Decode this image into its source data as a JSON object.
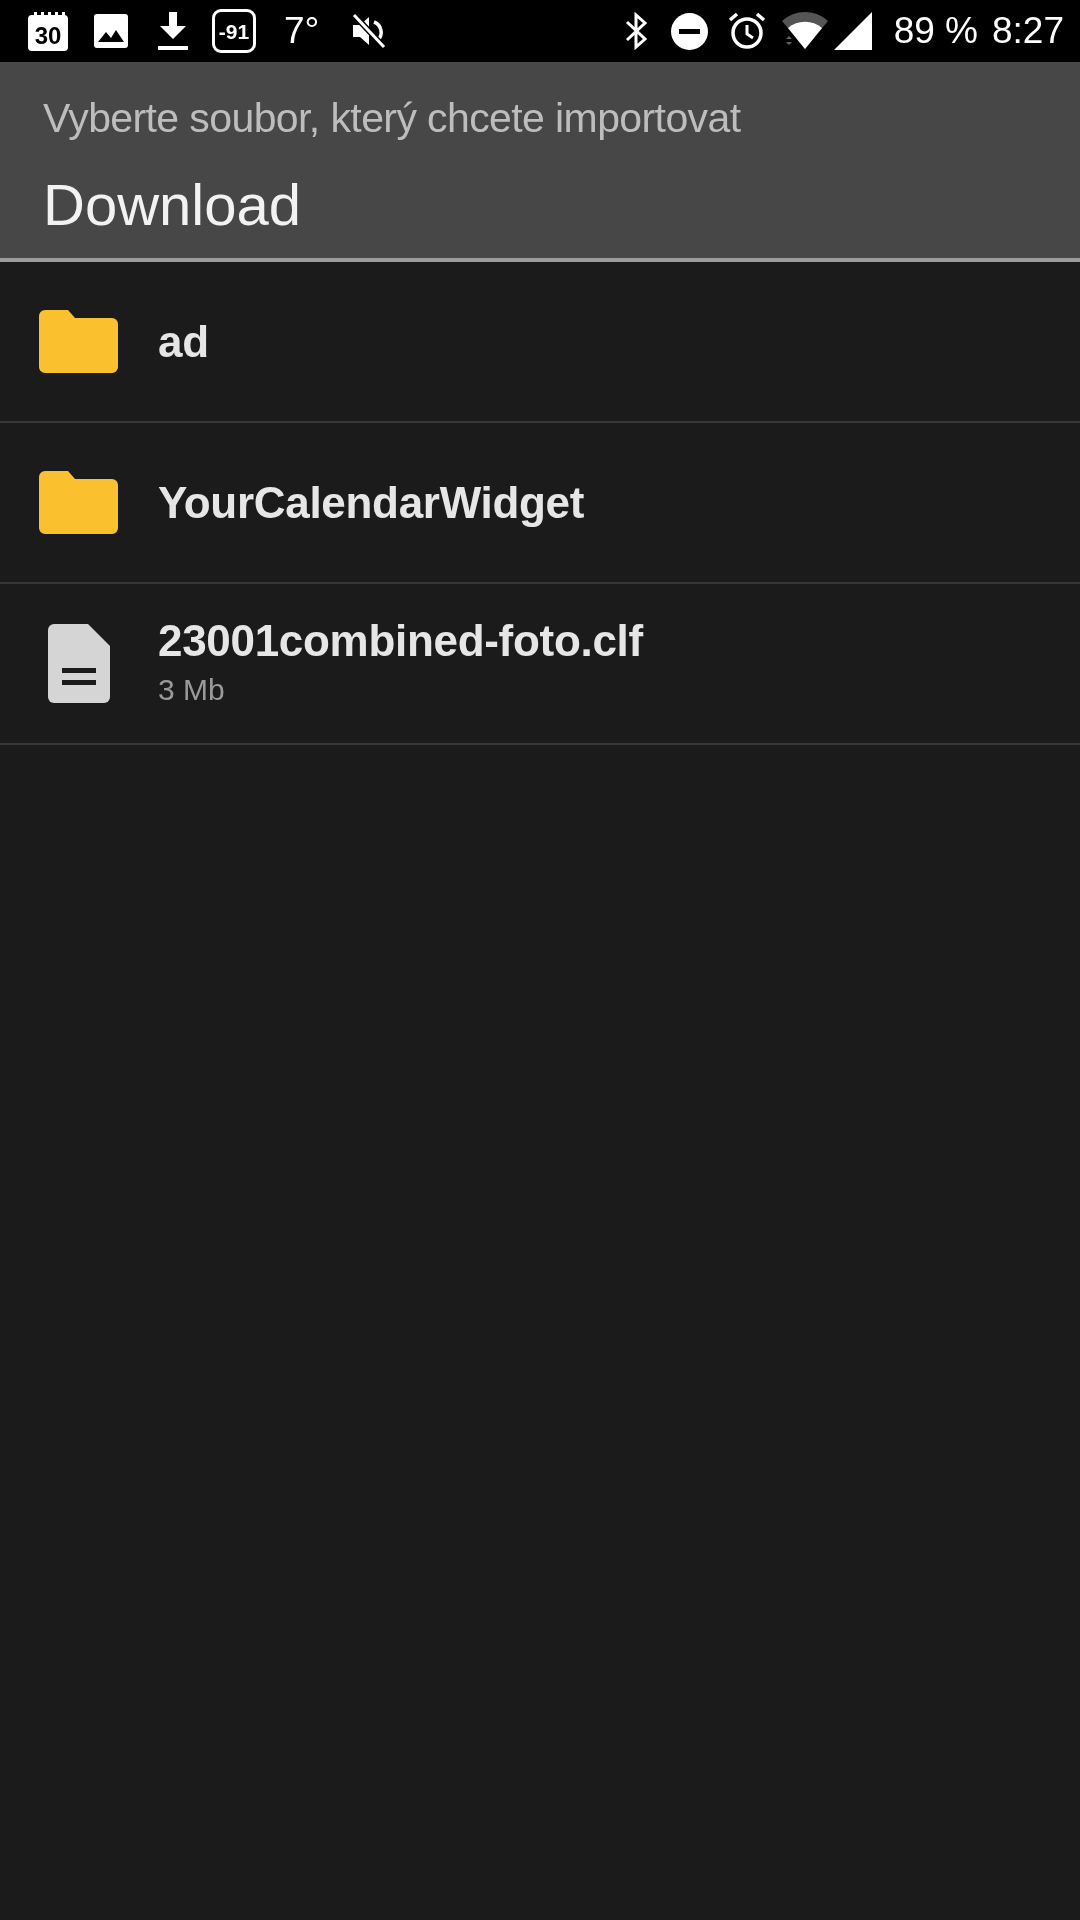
{
  "status_bar": {
    "calendar_day": "30",
    "number_badge": "-91",
    "temperature": "7°",
    "battery": "89 %",
    "time": "8:27"
  },
  "header": {
    "prompt": "Vyberte soubor, který chcete importovat",
    "folder": "Download"
  },
  "files": [
    {
      "kind": "folder",
      "name": "ad"
    },
    {
      "kind": "folder",
      "name": "YourCalendarWidget"
    },
    {
      "kind": "file",
      "name": "23001combined-foto.clf",
      "size": "3 Mb"
    }
  ]
}
